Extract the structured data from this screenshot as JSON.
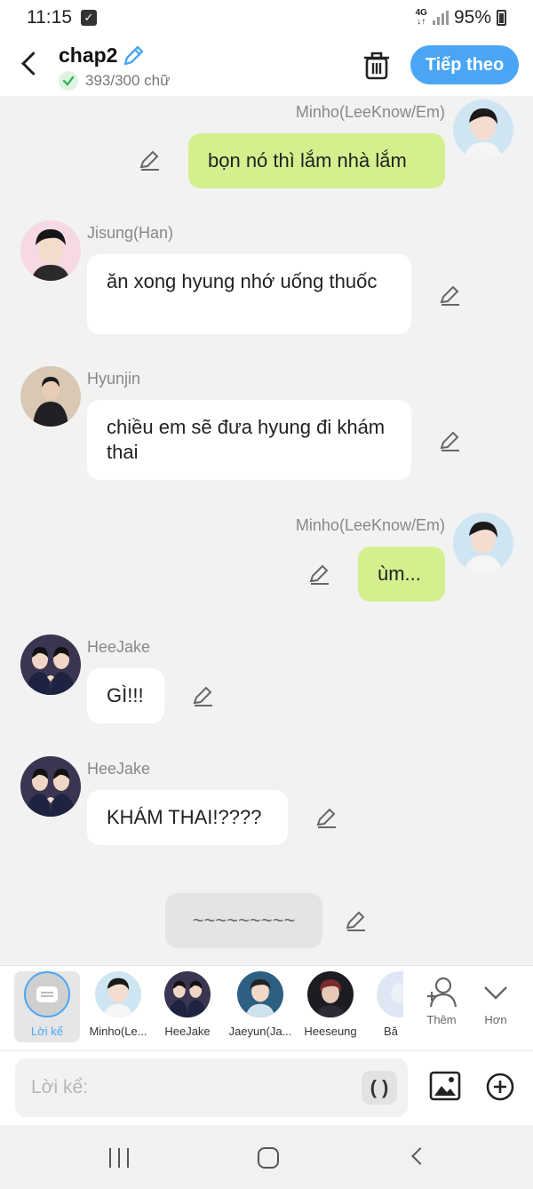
{
  "status_bar": {
    "time": "11:15",
    "network": "4G",
    "battery": "95%"
  },
  "header": {
    "title": "chap2",
    "word_count": "393/300 chữ",
    "next_label": "Tiếp theo"
  },
  "messages": [
    {
      "speaker": "Minho(LeeKnow/Em)",
      "text": "bọn nó thì lắm nhà lắm",
      "side": "right"
    },
    {
      "speaker": "Jisung(Han)",
      "text": "ăn xong hyung nhớ uống thuốc",
      "side": "left"
    },
    {
      "speaker": "Hyunjin",
      "text": "chiều em sẽ đưa hyung đi khám thai",
      "side": "left"
    },
    {
      "speaker": "Minho(LeeKnow/Em)",
      "text": "ùm...",
      "side": "right"
    },
    {
      "speaker": "HeeJake",
      "text": "GÌ!!!",
      "side": "left"
    },
    {
      "speaker": "HeeJake",
      "text": "KHÁM THAI!????",
      "side": "left"
    },
    {
      "speaker": "",
      "text": "~~~~~~~~~",
      "side": "narration"
    }
  ],
  "characters": [
    {
      "label": "Lời kể"
    },
    {
      "label": "Minho(Le..."
    },
    {
      "label": "HeeJake"
    },
    {
      "label": "Jaeyun(Ja..."
    },
    {
      "label": "Heeseung"
    },
    {
      "label": "Bă"
    }
  ],
  "tools": {
    "add_label": "Thêm",
    "more_label": "Hơn"
  },
  "input": {
    "placeholder": "Lời kể:",
    "paren_label": "( )"
  },
  "colors": {
    "accent": "#4aa6f5",
    "user_bubble": "#d4f08e",
    "other_bubble": "#ffffff"
  }
}
